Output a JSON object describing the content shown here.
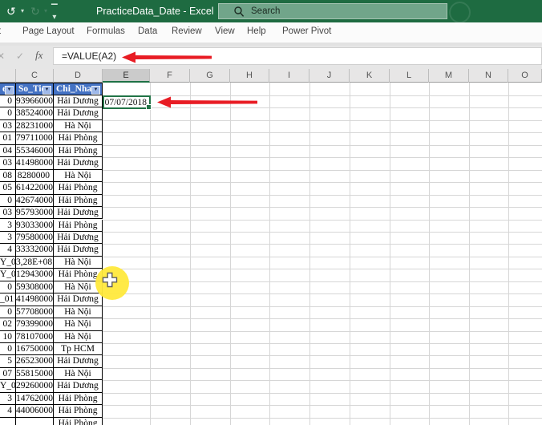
{
  "titlebar": {
    "title": "PracticeData_Date - Excel",
    "search_placeholder": "Search"
  },
  "ribbon": {
    "tabs": [
      "rt",
      "Page Layout",
      "Formulas",
      "Data",
      "Review",
      "View",
      "Help",
      "Power Pivot"
    ]
  },
  "formula_bar": {
    "formula": "=VALUE(A2)",
    "fx_label": "fx",
    "cancel_glyph": "✕",
    "enter_glyph": "✓"
  },
  "grid": {
    "column_headers": [
      "C",
      "D",
      "E",
      "F",
      "G",
      "H",
      "I",
      "J",
      "K",
      "L",
      "M",
      "N",
      "O"
    ],
    "selected_column": "E",
    "filter_row": {
      "b_partial": "e",
      "so_tien": "So_Tie",
      "chi_nhanh": "Chi_Nha"
    },
    "selected_cell": {
      "address": "E2",
      "value": "07/07/2018"
    },
    "rows": [
      {
        "b": "0",
        "c": "93966000",
        "d": "Hải Dương"
      },
      {
        "b": "0",
        "c": "38524000",
        "d": "Hải Dương"
      },
      {
        "b": "03",
        "c": "28231000",
        "d": "Hà Nội"
      },
      {
        "b": "01",
        "c": "79711000",
        "d": "Hải Phòng"
      },
      {
        "b": "04",
        "c": "55346000",
        "d": "Hải Phòng"
      },
      {
        "b": "03",
        "c": "41498000",
        "d": "Hải Dương"
      },
      {
        "b": "08",
        "c": "8280000",
        "d": "Hà Nội"
      },
      {
        "b": "05",
        "c": "61422000",
        "d": "Hải Phòng"
      },
      {
        "b": "0",
        "c": "42674000",
        "d": "Hải Phòng"
      },
      {
        "b": "03",
        "c": "95793000",
        "d": "Hải Dương"
      },
      {
        "b": "3",
        "c": "93033000",
        "d": "Hải Phòng"
      },
      {
        "b": "3",
        "c": "79580000",
        "d": "Hải Dương"
      },
      {
        "b": "4",
        "c": "33332000",
        "d": "Hải Dương"
      },
      {
        "b": "Y_0",
        "c": "3,28E+08",
        "d": "Hà Nội"
      },
      {
        "b": "Y_0",
        "c": "12943000",
        "d": "Hải Phòng"
      },
      {
        "b": "0",
        "c": "59308000",
        "d": "Hà Nội"
      },
      {
        "b": "_01",
        "c": "41498000",
        "d": "Hải Dương"
      },
      {
        "b": "0",
        "c": "57708000",
        "d": "Hà Nội"
      },
      {
        "b": "02",
        "c": "79399000",
        "d": "Hà Nội"
      },
      {
        "b": "10",
        "c": "78107000",
        "d": "Hà Nội"
      },
      {
        "b": "0",
        "c": "16750000",
        "d": "Tp HCM"
      },
      {
        "b": "5",
        "c": "26523000",
        "d": "Hải Dương"
      },
      {
        "b": "07",
        "c": "55815000",
        "d": "Hà Nội"
      },
      {
        "b": "Y_0",
        "c": "29260000",
        "d": "Hải Dương"
      },
      {
        "b": "3",
        "c": "14762000",
        "d": "Hải Phòng"
      },
      {
        "b": "4",
        "c": "44006000",
        "d": "Hải Phòng"
      }
    ],
    "partial_row": {
      "b": "",
      "c": "",
      "d": "Hải Phòng"
    }
  },
  "colors": {
    "titlebar_green": "#1e6b41",
    "selection_green": "#217346",
    "header_blue": "#4472c4",
    "arrow_red": "#e81c24",
    "highlight_yellow": "#ffe93c"
  }
}
